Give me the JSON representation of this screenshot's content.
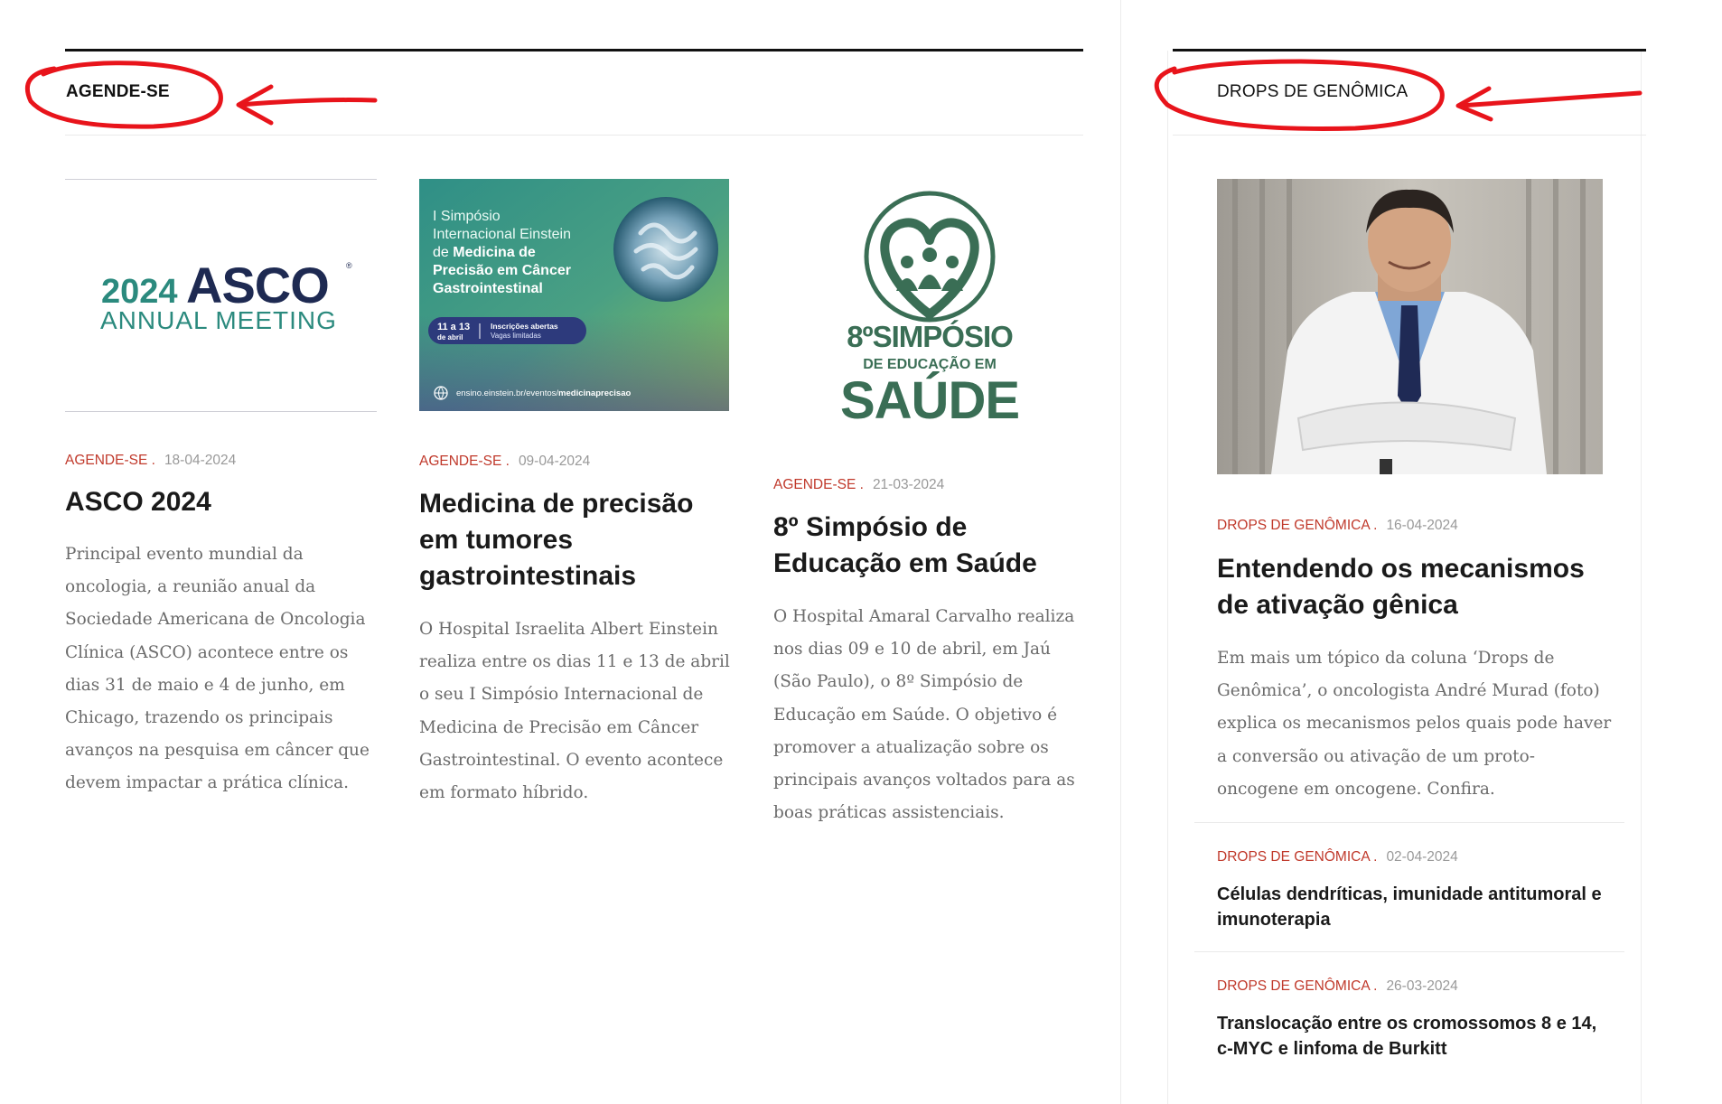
{
  "agende": {
    "section_title": "AGENDE-SE",
    "cards": [
      {
        "category": "AGENDE-SE",
        "date": "18-04-2024",
        "title": "ASCO 2024",
        "excerpt": "Principal evento mundial da oncologia, a reunião anual da Sociedade Americana de Oncologia Clínica (ASCO) acontece entre os dias 31 de maio e 4 de junho, em Chicago, trazendo os principais avanços na pesquisa em câncer que devem impactar a prática clínica.",
        "image": {
          "year": "2024",
          "brand": "ASCO",
          "subtitle": "ANNUAL MEETING"
        }
      },
      {
        "category": "AGENDE-SE",
        "date": "09-04-2024",
        "title": "Medicina de precisão em tumores gastrointestinais",
        "excerpt": "O Hospital Israelita Albert Einstein realiza entre os dias 11 e 13 de abril o seu I Simpósio Internacional de Medicina de Precisão em Câncer Gastrointestinal. O evento acontece em formato híbrido.",
        "image": {
          "line1": "I Simpósio",
          "line2": "Internacional Einstein",
          "line3_light": "de ",
          "line3_bold": "Medicina de",
          "line4": "Precisão em Câncer",
          "line5": "Gastrointestinal",
          "dates_top": "11 a 13",
          "dates_bottom": "de abril",
          "badge_top": "Inscrições abertas",
          "badge_bottom": "Vagas limitadas",
          "url_light": "ensino.einstein.br/eventos/",
          "url_bold": "medicinaprecisao"
        }
      },
      {
        "category": "AGENDE-SE",
        "date": "21-03-2024",
        "title": "8º Simpósio de Educação em Saúde",
        "excerpt": "O Hospital Amaral Carvalho realiza nos dias 09 e 10 de abril, em Jaú (São Paulo), o 8º Simpósio de Educação em Saúde. O objetivo é promover a atualização sobre os principais avanços voltados para as boas práticas assistenciais.",
        "image": {
          "line1": "8ºSIMPÓSIO",
          "line2": "DE EDUCAÇÃO EM",
          "line3": "SAÚDE"
        }
      }
    ]
  },
  "drops": {
    "section_title": "DROPS DE GENÔMICA",
    "featured": {
      "category": "DROPS DE GENÔMICA",
      "date": "16-04-2024",
      "title": "Entendendo os mecanismos de ativação gênica",
      "excerpt": "Em mais um tópico da coluna ‘Drops de Genômica’, o oncologista André Murad (foto) explica os mecanismos pelos quais pode haver a conversão ou ativação de um proto-oncogene em oncogene. Confira."
    },
    "items": [
      {
        "category": "DROPS DE GENÔMICA",
        "date": "02-04-2024",
        "title": "Células dendríticas, imunidade antitumoral e imunoterapia"
      },
      {
        "category": "DROPS DE GENÔMICA",
        "date": "26-03-2024",
        "title": "Translocação entre os cromossomos 8 e 14, c-MYC e linfoma de Burkitt"
      }
    ]
  },
  "colors": {
    "category": "#c0392b",
    "annotation": "#e8141b",
    "einstein_gradient_start": "#2f8f86",
    "einstein_gradient_end": "#8cc05a",
    "saude_green": "#3a6e55",
    "asco_navy": "#1e2a52",
    "asco_teal": "#2b8a7e"
  }
}
